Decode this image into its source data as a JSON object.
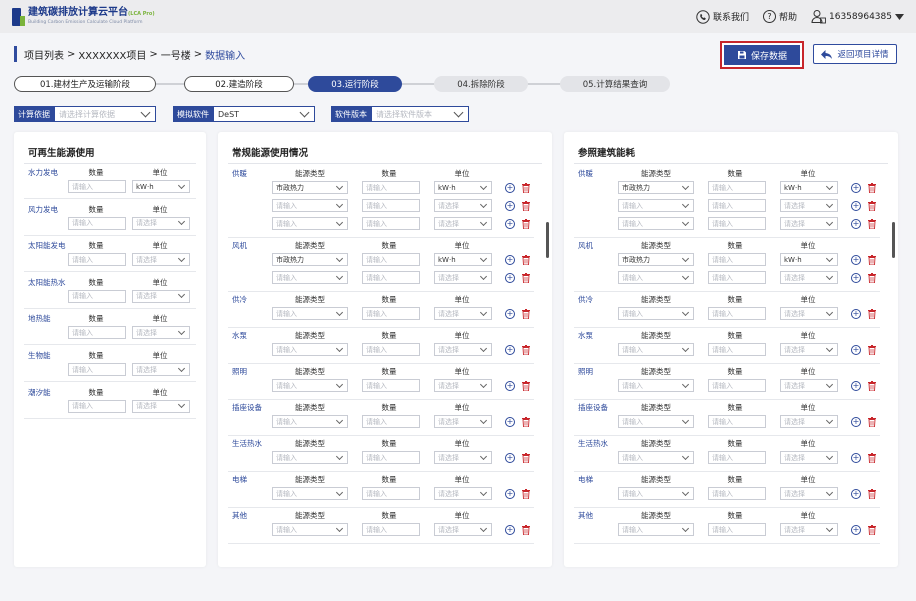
{
  "topbar": {
    "logo_title": "建筑碳排放计算云平台",
    "logo_tag": "(LCA Pro)",
    "logo_sub": "Building Carbon Emission Calculate Cloud Platform",
    "contact": "联系我们",
    "help": "帮助",
    "user": "16358964385"
  },
  "breadcrumb": {
    "p1": "项目列表",
    "sep": ">",
    "p2": "XXXXXXX项目",
    "p3": "一号楼",
    "p4": "数据输入"
  },
  "actions": {
    "save": "保存数据",
    "back": "返回项目详情"
  },
  "steps": [
    {
      "label": "01.建材生产及运输阶段",
      "state": "done"
    },
    {
      "label": "02.建造阶段",
      "state": "done"
    },
    {
      "label": "03.运行阶段",
      "state": "active"
    },
    {
      "label": "04.拆除阶段",
      "state": "todo"
    },
    {
      "label": "05.计算结果查询",
      "state": "todo"
    }
  ],
  "filters": [
    {
      "label": "计算依据",
      "value": "",
      "placeholder": "请选择计算依据"
    },
    {
      "label": "模拟软件",
      "value": "DeST",
      "placeholder": ""
    },
    {
      "label": "软件版本",
      "value": "",
      "placeholder": "请选择软件版本"
    }
  ],
  "placeholders": {
    "input": "请输入",
    "select": "请选择"
  },
  "renewable": {
    "title": "可再生能源使用",
    "col_qty": "数量",
    "col_unit": "单位",
    "unit_selected": "kW·h",
    "items": [
      "水力发电",
      "风力发电",
      "太阳能发电",
      "太阳能热水",
      "地热能",
      "生物能",
      "潮汐能"
    ]
  },
  "conventional": {
    "title": "常规能源使用情况",
    "col_type": "能源类型",
    "col_qty": "数量",
    "col_unit": "单位",
    "type_selected": "市政热力",
    "unit_selected": "kW·h",
    "groups": [
      {
        "name": "供暖",
        "rows": 3,
        "filled": 1
      },
      {
        "name": "风机",
        "rows": 2,
        "filled": 1
      },
      {
        "name": "供冷",
        "rows": 1,
        "filled": 0
      },
      {
        "name": "水泵",
        "rows": 1,
        "filled": 0
      },
      {
        "name": "照明",
        "rows": 1,
        "filled": 0
      },
      {
        "name": "插座设备",
        "rows": 1,
        "filled": 0
      },
      {
        "name": "生活热水",
        "rows": 1,
        "filled": 0
      },
      {
        "name": "电梯",
        "rows": 1,
        "filled": 0
      },
      {
        "name": "其他",
        "rows": 1,
        "filled": 0
      }
    ]
  },
  "reference": {
    "title": "参照建筑能耗"
  },
  "colors": {
    "primary": "#2e4a9b",
    "accent_green": "#7ab33b",
    "danger": "#c8262b"
  }
}
